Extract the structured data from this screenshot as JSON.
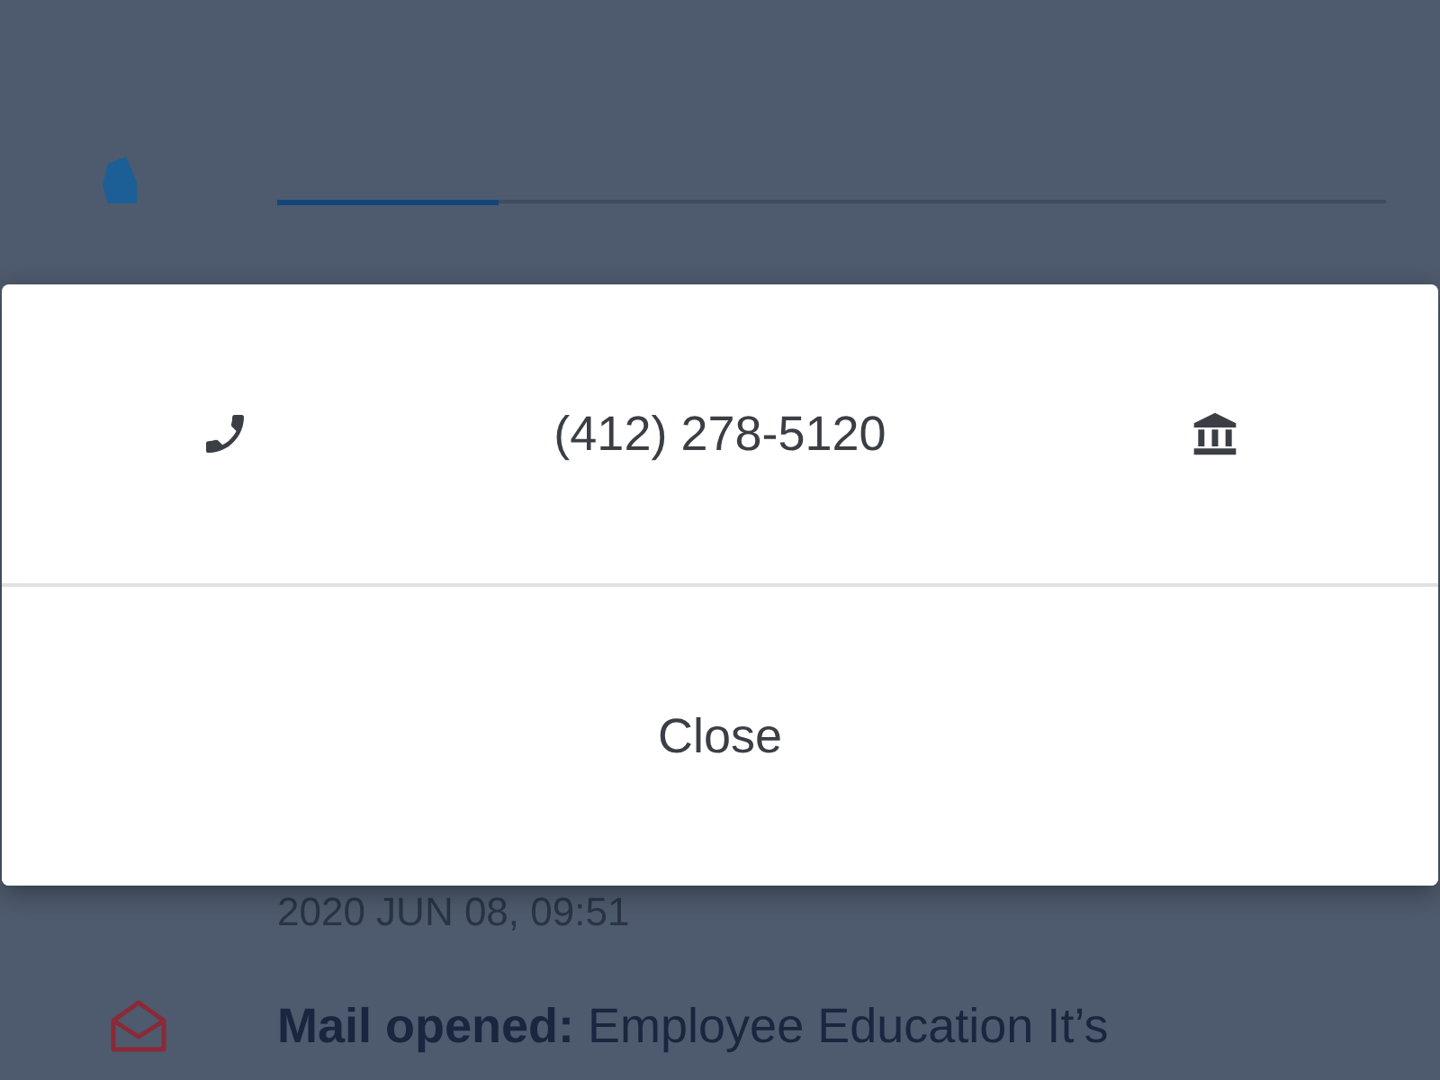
{
  "background": {
    "progress": {
      "level": 0.2
    },
    "activity": {
      "timestamp": "2020 JUN 08, 09:51",
      "label": "Mail opened:",
      "subject": "Employee Education It’s"
    }
  },
  "dialog": {
    "phone": "(412) 278-5120",
    "button": "Close"
  }
}
